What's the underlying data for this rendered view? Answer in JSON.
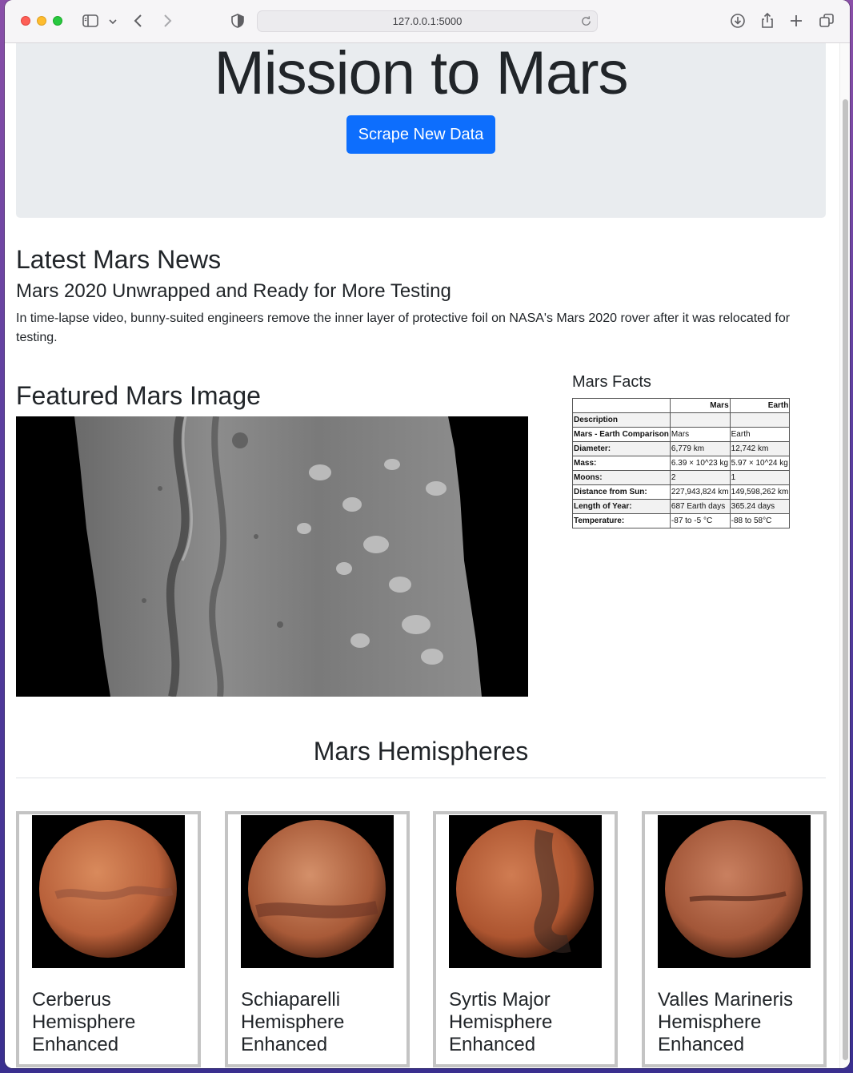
{
  "browser": {
    "url": "127.0.0.1:5000"
  },
  "header": {
    "title": "Mission to Mars",
    "scrape_button": "Scrape New Data"
  },
  "news": {
    "heading": "Latest Mars News",
    "title": "Mars 2020 Unwrapped and Ready for More Testing",
    "paragraph": "In time-lapse video, bunny-suited engineers remove the inner layer of protective foil on NASA's Mars 2020 rover after it was relocated for testing."
  },
  "featured": {
    "heading": "Featured Mars Image"
  },
  "facts": {
    "heading": "Mars Facts",
    "columns": [
      "",
      "Mars",
      "Earth"
    ],
    "rows": [
      {
        "label": "Description",
        "mars": "",
        "earth": ""
      },
      {
        "label": "Mars - Earth Comparison",
        "mars": "Mars",
        "earth": "Earth"
      },
      {
        "label": "Diameter:",
        "mars": "6,779 km",
        "earth": "12,742 km"
      },
      {
        "label": "Mass:",
        "mars": "6.39 × 10^23 kg",
        "earth": "5.97 × 10^24 kg"
      },
      {
        "label": "Moons:",
        "mars": "2",
        "earth": "1"
      },
      {
        "label": "Distance from Sun:",
        "mars": "227,943,824 km",
        "earth": "149,598,262 km"
      },
      {
        "label": "Length of Year:",
        "mars": "687 Earth days",
        "earth": "365.24 days"
      },
      {
        "label": "Temperature:",
        "mars": "-87 to -5 °C",
        "earth": "-88 to 58°C"
      }
    ]
  },
  "hemispheres": {
    "heading": "Mars Hemispheres",
    "items": [
      {
        "title": "Cerberus Hemisphere Enhanced"
      },
      {
        "title": "Schiaparelli Hemisphere Enhanced"
      },
      {
        "title": "Syrtis Major Hemisphere Enhanced"
      },
      {
        "title": "Valles Marineris Hemisphere Enhanced"
      }
    ]
  },
  "colors": {
    "accent": "#0d6efd",
    "jumbotron_bg": "#e9ecef",
    "mars_orange": "#c0603a"
  }
}
